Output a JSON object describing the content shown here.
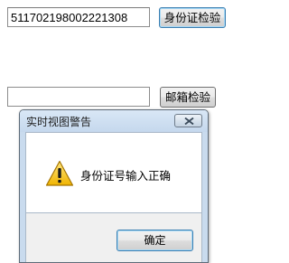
{
  "form": {
    "idcard_value": "511702198002221308",
    "idcard_button_label": "身份证检验",
    "email_value": "",
    "email_button_label": "邮箱检验"
  },
  "dialog": {
    "title": "实时视图警告",
    "message": "身份证号输入正确",
    "ok_label": "确定",
    "icon": "warning-icon"
  }
}
